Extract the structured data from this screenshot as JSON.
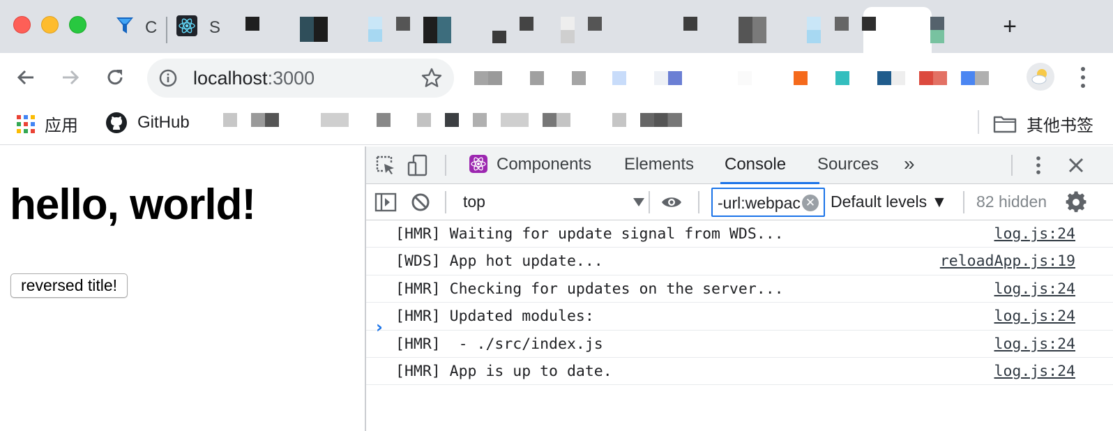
{
  "browser": {
    "tabs": [
      {
        "title": "C",
        "icon": "funnel-icon"
      },
      {
        "title": "S",
        "icon": "react-icon"
      }
    ],
    "new_tab_label": "+",
    "address": {
      "host": "localhost",
      "port": ":3000"
    },
    "bookmarks": {
      "apps_label": "应用",
      "github_label": "GitHub",
      "other_label": "其他书签"
    }
  },
  "page": {
    "heading": "hello, world!",
    "button_label": "reversed title!"
  },
  "devtools": {
    "tabs": [
      "Components",
      "Elements",
      "Console",
      "Sources"
    ],
    "active_tab": "Console",
    "more_tabs": "»",
    "context": "top",
    "filter_value": "-url:webpack",
    "levels_label": "Default levels ▼",
    "hidden_label": "82 hidden",
    "prompt_symbol": "›",
    "logs": [
      {
        "message": "[HMR] Waiting for update signal from WDS...",
        "source": "log.js:24"
      },
      {
        "message": "[WDS] App hot update...",
        "source": "reloadApp.js:19"
      },
      {
        "message": "[HMR] Checking for updates on the server...",
        "source": "log.js:24"
      },
      {
        "message": "[HMR] Updated modules:",
        "source": "log.js:24"
      },
      {
        "message": "[HMR]  - ./src/index.js",
        "source": "log.js:24"
      },
      {
        "message": "[HMR] App is up to date.",
        "source": "log.js:24"
      }
    ]
  },
  "colors": {
    "accent": "#1a73e8",
    "tabstrip_bg": "#dee1e6",
    "devtools_bar_bg": "#f1f3f4"
  }
}
